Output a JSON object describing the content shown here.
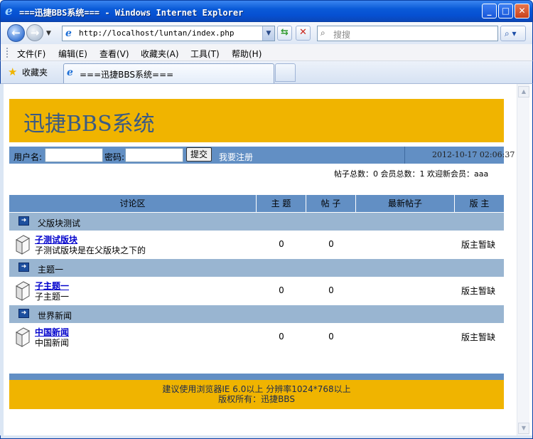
{
  "window": {
    "title": "===迅捷BBS系统=== - Windows Internet Explorer"
  },
  "nav": {
    "url": "http://localhost/luntan/index.php",
    "search_placeholder": "搜搜"
  },
  "menu": [
    "文件(F)",
    "编辑(E)",
    "查看(V)",
    "收藏夹(A)",
    "工具(T)",
    "帮助(H)"
  ],
  "favorites_label": "收藏夹",
  "tab_title": "===迅捷BBS系统===",
  "page": {
    "logo": "迅捷BBS系统",
    "login": {
      "username_label": "用户名:",
      "password_label": "密码:",
      "username_value": "",
      "password_value": "",
      "submit_label": "提交",
      "register_link": "我要注册",
      "datetime": "2012-10-17 02:06:37"
    },
    "stats": "帖子总数：0  会员总数：1  欢迎新会员：aaa",
    "table_headers": [
      "讨论区",
      "主 题",
      "帖 子",
      "最新帖子",
      "版 主"
    ],
    "categories": [
      {
        "name": "父版块测试",
        "board": {
          "name": "子测试版块",
          "desc": "子测试版块是在父版块之下的",
          "topics": "0",
          "posts": "0",
          "moderator": "版主暂缺"
        }
      },
      {
        "name": "主题一",
        "board": {
          "name": "子主题一",
          "desc": "子主题一",
          "topics": "0",
          "posts": "0",
          "moderator": "版主暂缺"
        }
      },
      {
        "name": "世界新闻",
        "board": {
          "name": "中国新闻",
          "desc": "中国新闻",
          "topics": "0",
          "posts": "0",
          "moderator": "版主暂缺"
        }
      }
    ],
    "footer": {
      "line1": "建议使用浏览器IE 6.0以上  分辨率1024*768以上",
      "line2": "版权所有：迅捷BBS"
    }
  },
  "colors": {
    "banner": "#f0b400",
    "bar_blue": "#628fc4",
    "category_row": "#99b5d1",
    "logo_text": "#3a5a84"
  }
}
